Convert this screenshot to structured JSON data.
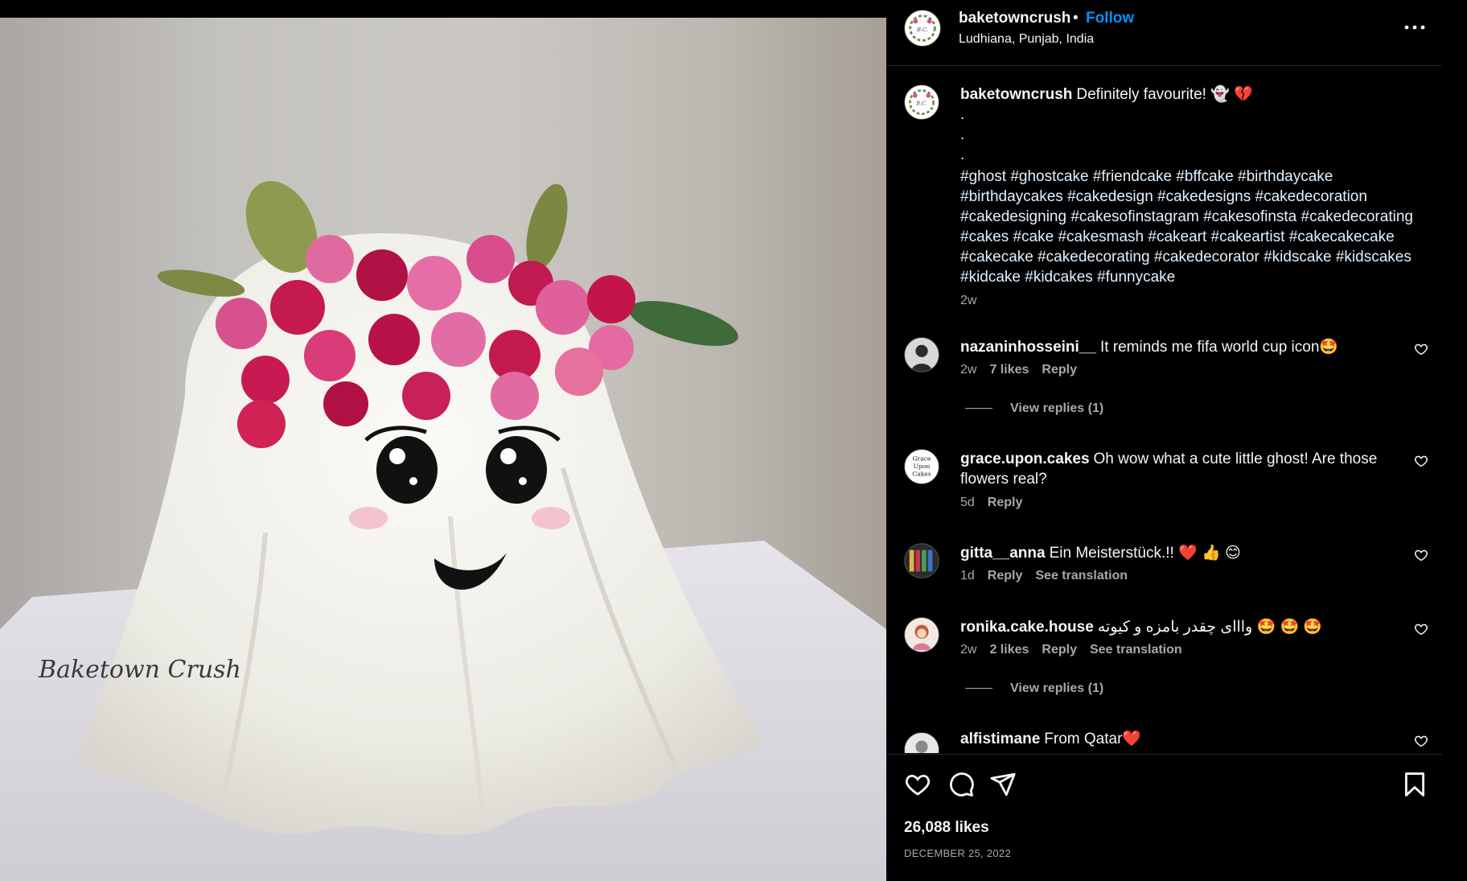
{
  "photo": {
    "watermark": "Baketown Crush",
    "bg_color": "#c4c2bf",
    "ghost_color": "#f4f3ee"
  },
  "header": {
    "username": "baketowncrush",
    "dot": "•",
    "follow_label": "Follow",
    "location": "Ludhiana, Punjab, India"
  },
  "caption": {
    "username": "baketowncrush",
    "text": "Definitely favourite! 👻 💔",
    "dots": [
      ".",
      ".",
      "."
    ],
    "hashtags": "#ghost #ghostcake #friendcake #bffcake #birthdaycake #birthdaycakes #cakedesign #cakedesigns #cakedecoration #cakedesigning #cakesofinstagram #cakesofinsta #cakedecorating #cakes #cake #cakesmash #cakeart #cakeartist #cakecakecake #cakecake #cakedecorating #cakedecorator #kidscake #kidscakes #kidcake #kidcakes #funnycake",
    "time": "2w"
  },
  "comments": [
    {
      "username": "nazaninhosseini__",
      "text": "It reminds me fifa world cup icon🤩",
      "time": "2w",
      "likes": "7 likes",
      "reply": "Reply",
      "view_replies": "View replies (1)"
    },
    {
      "username": "grace.upon.cakes",
      "text": "Oh wow what a cute little ghost! Are those flowers real?",
      "time": "5d",
      "reply": "Reply",
      "avatar_text": "Grace Upon Cakes"
    },
    {
      "username": "gitta__anna",
      "text": "Ein Meisterstück.!! ❤️ 👍 😊",
      "time": "1d",
      "reply": "Reply",
      "translate": "See translation"
    },
    {
      "username": "ronika.cake.house",
      "text": "وااای چقدر بامزه و کیوته 🤩 🤩 🤩",
      "time": "2w",
      "likes": "2 likes",
      "reply": "Reply",
      "translate": "See translation",
      "view_replies": "View replies (1)"
    },
    {
      "username": "alfistimane",
      "text": "From Qatar❤️"
    }
  ],
  "actions": {
    "likes": "26,088 likes",
    "date": "DECEMBER 25, 2022"
  },
  "colors": {
    "accent": "#0095f6",
    "muted": "#a8a8a8",
    "divider": "#262626"
  }
}
